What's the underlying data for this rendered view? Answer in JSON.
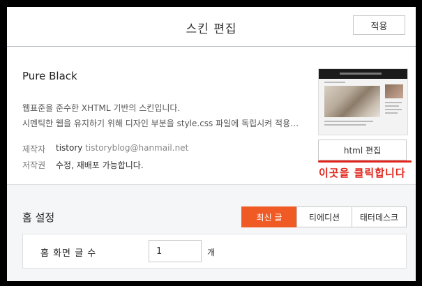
{
  "header": {
    "title": "스킨 편집",
    "apply_label": "적용"
  },
  "skin": {
    "name": "Pure Black",
    "description_line1": "웹표준을 준수한 XHTML 기반의 스킨입니다.",
    "description_line2": "시멘틱한 웹을 유지하기 위해 디자인 부분을 style.css 파일에 독립시켜 적용…",
    "author_label": "제작자",
    "author_name": "tistory",
    "author_email": "tistoryblog@hanmail.net",
    "license_label": "저작권",
    "license_value": "수정, 재배포 가능합니다.",
    "html_edit_label": "html 편집"
  },
  "annotation": {
    "text": "이곳을 클릭합니다",
    "color": "#e0261c"
  },
  "home": {
    "title": "홈 설정",
    "tabs": [
      {
        "label": "최신 글",
        "active": true
      },
      {
        "label": "티에디션",
        "active": false
      },
      {
        "label": "태터데스크",
        "active": false
      }
    ],
    "post_count_label": "홈 화면 글 수",
    "post_count_value": "1",
    "post_count_unit": "개"
  },
  "colors": {
    "accent": "#f05a24",
    "annotation": "#e0261c"
  }
}
